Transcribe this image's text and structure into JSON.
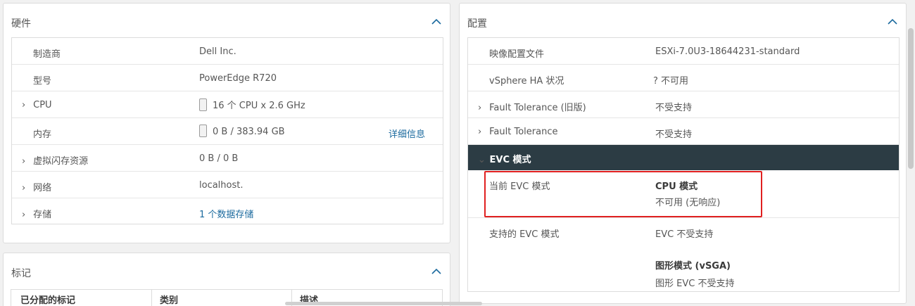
{
  "hardware": {
    "title": "硬件",
    "rows": [
      {
        "label": "制造商",
        "value": "Dell Inc.",
        "expandable": false
      },
      {
        "label": "型号",
        "value": "PowerEdge R720",
        "expandable": false
      },
      {
        "label": "CPU",
        "value": "16 个 CPU x 2.6 GHz",
        "expandable": true,
        "bar": true
      },
      {
        "label": "内存",
        "value": "0 B / 383.94 GB",
        "expandable": false,
        "bar": true,
        "link": "详细信息"
      },
      {
        "label": "虚拟闪存资源",
        "value": "0 B / 0 B",
        "expandable": true
      },
      {
        "label": "网络",
        "value": "localhost.",
        "expandable": true
      },
      {
        "label": "存储",
        "value": "1 个数据存储",
        "expandable": true,
        "value_is_link": true
      }
    ]
  },
  "config": {
    "title": "配置",
    "rows": [
      {
        "label": "映像配置文件",
        "value": "ESXi-7.0U3-18644231-standard"
      },
      {
        "label": "vSphere HA 状况",
        "value": "?  不可用"
      },
      {
        "label": "Fault Tolerance (旧版)",
        "value": "不受支持"
      },
      {
        "label": "Fault Tolerance",
        "value": "不受支持"
      }
    ],
    "evc": {
      "header": "EVC 模式",
      "current_label": "当前 EVC 模式",
      "cpu_mode_title": "CPU 模式",
      "cpu_mode_value": "不可用 (无响应)",
      "supported_label": "支持的 EVC 模式",
      "supported_value": "EVC 不受支持",
      "graphics_title": "图形模式 (vSGA)",
      "graphics_value": "图形 EVC 不受支持"
    }
  },
  "tags": {
    "title": "标记",
    "columns": [
      "已分配的标记",
      "类别",
      "描述"
    ]
  },
  "colors": {
    "accent": "#1b6a9e",
    "evc_header_bg": "#2c3c44",
    "highlight": "#e02020"
  }
}
